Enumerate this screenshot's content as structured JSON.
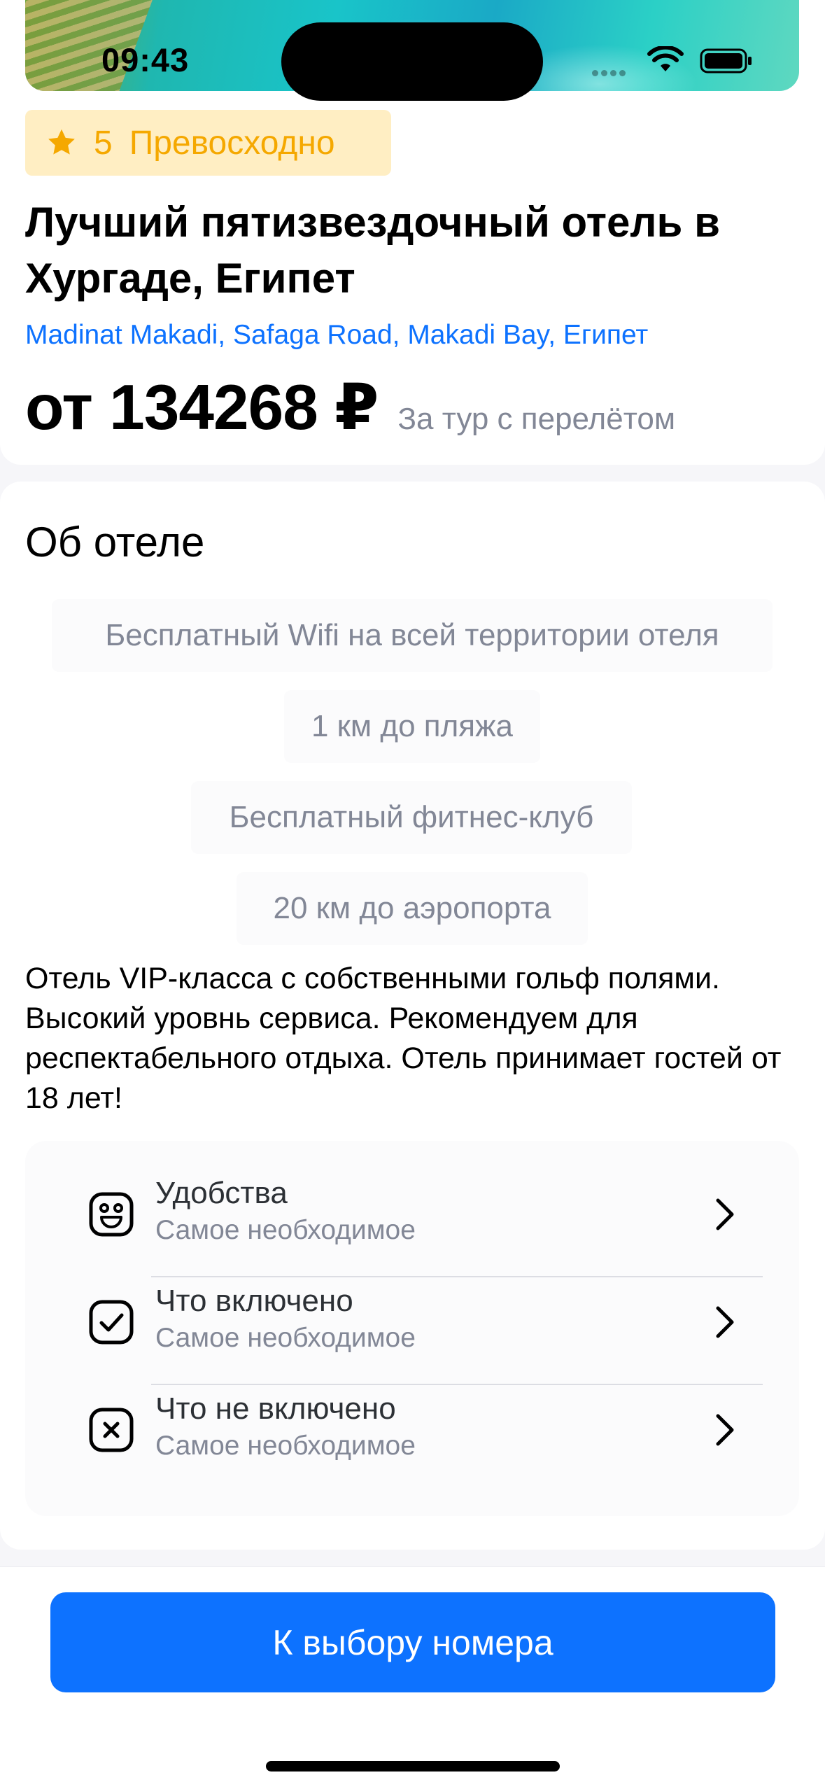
{
  "status_bar": {
    "time": "09:43"
  },
  "hotel": {
    "rating_value": "5",
    "rating_label": "Превосходно",
    "title": "Лучший пятизвездочный отель в Хургаде, Египет",
    "address": "Madinat Makadi, Safaga Road, Makadi Bay, Египет",
    "price": "от 134268 ₽",
    "price_note": "За тур с перелётом"
  },
  "about": {
    "title": "Об отеле",
    "peculiarities": [
      "Бесплатный Wifi на всей территории отеля",
      "1 км до пляжа",
      "Бесплатный фитнес-клуб",
      "20 км до аэропорта"
    ],
    "description": "Отель VIP-класса с собственными гольф полями. Высокий уровнь сервиса. Рекомендуем для респектабельного отдыха. Отель принимает гостей от 18 лет!",
    "details": [
      {
        "title": "Удобства",
        "subtitle": "Самое необходимое",
        "icon": "emoji-happy-icon"
      },
      {
        "title": "Что включено",
        "subtitle": "Самое необходимое",
        "icon": "tick-square-icon"
      },
      {
        "title": "Что не включено",
        "subtitle": "Самое необходимое",
        "icon": "close-square-icon"
      }
    ]
  },
  "bottom": {
    "button_label": "К выбору номера"
  },
  "colors": {
    "accent": "#0D72FF",
    "rating_bg": "#FFEEC3",
    "rating_fg": "#F5A800",
    "muted_text": "#828796",
    "page_bg": "#F6F6F9"
  }
}
